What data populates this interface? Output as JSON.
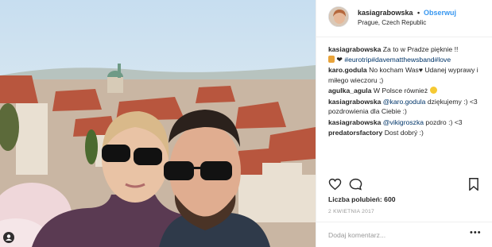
{
  "post": {
    "username": "kasiagrabowska",
    "separator": "•",
    "follow_label": "Obserwuj",
    "location": "Prague, Czech Republic",
    "likes_label": "Liczba polubień: 600",
    "date": "2 KWIETNIA 2017",
    "add_comment_placeholder": "Dodaj komentarz...",
    "more_options": "•••"
  },
  "comments": [
    {
      "user": "kasiagrabowska",
      "text": "Za to w Pradze pięknie !!",
      "line2": "#eurotrip#davematthewsband#love"
    },
    {
      "user": "karo.godula",
      "text": "No kocham Was♥ Udanej wyprawy i miłego wieczoru ;)"
    },
    {
      "user": "agulka_agula",
      "text": "W Polsce również"
    },
    {
      "user": "kasiagrabowska",
      "mention": "@karo.godula",
      "text": "dziękujemy :) <3 pozdrowienia dla Ciebie :)"
    },
    {
      "user": "kasiagrabowska",
      "mention": "@vikigroszka",
      "text": "pozdro :) <3"
    },
    {
      "user": "predatorsfactory",
      "text": "Dost dobrý :)"
    }
  ],
  "colors": {
    "link": "#3897f0",
    "hashtag": "#003569",
    "muted": "#999999",
    "border": "#efefef"
  },
  "icons": [
    "heart-icon",
    "comment-icon",
    "bookmark-icon",
    "user-tag-icon"
  ]
}
